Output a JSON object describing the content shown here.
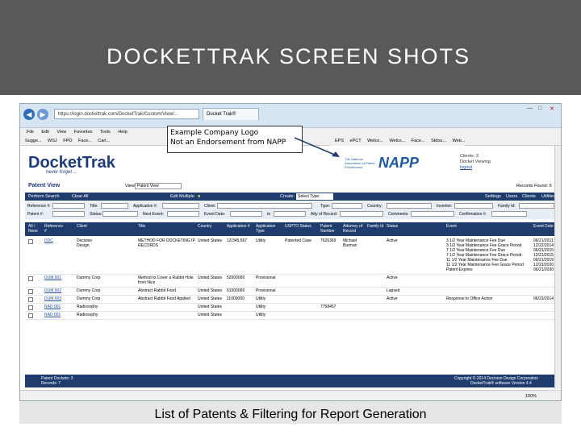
{
  "slide": {
    "title": "DOCKETTRAK SCREEN SHOTS",
    "caption": "List of Patents & Filtering for Report Generation"
  },
  "browser": {
    "url": "https://login.dockettrak.com/DocketTrak/Custom/View/...",
    "tab_label": "Docket Trak®",
    "back_icon": "back-arrow-icon",
    "forward_icon": "forward-arrow-icon",
    "menu": [
      "File",
      "Edit",
      "View",
      "Favorites",
      "Tools",
      "Help"
    ],
    "favorites": [
      "Sugge...",
      "WSJ",
      "FPO",
      "Face...",
      "Carl..."
    ],
    "favorites_right": [
      "EPS",
      "ePCT",
      "Welco...",
      "Welco...",
      "Face...",
      "Stdou...",
      "Web..."
    ],
    "zoom": "100%"
  },
  "callout": {
    "line1": "Example Company Logo",
    "line2": "Not an Endorsement from NAPP"
  },
  "header": {
    "logo_docket": "Docket",
    "logo_trak": "Trak",
    "tagline": "never forget ...",
    "napp_small": "The National Association of Patent Practitioners",
    "napp_word": "NAPP",
    "client_line1": "Clients: 3",
    "client_line2": "Docket Viewing",
    "client_line3": "logout"
  },
  "patent_view": {
    "title": "Patent View",
    "view_label": "View:",
    "view_value": "Patent View",
    "records_found": "Records Found: 6"
  },
  "toolbar": {
    "perform_search": "Perform Search",
    "clear_all": "Clear All",
    "edit_multiple": "Edit Multiple",
    "create_label": "Create:",
    "create_value": "Select Type:",
    "settings": "Settings",
    "users": "Users",
    "clients": "Clients",
    "utilities": "Utilities"
  },
  "filters": {
    "reference": "Reference #:",
    "title": "Title:",
    "application": "Application #:",
    "client": "Client:",
    "type": "Type:",
    "country": "Country:",
    "inventor": "Inventor:",
    "family_id": "Family Id:",
    "patent": "Patent #:",
    "status": "Status:",
    "next_event": "Next Event:",
    "event_date": "Event Date:",
    "to": "to",
    "atty": "Atty of Record:",
    "comments": "Comments:",
    "confirmation": "Confirmation #:"
  },
  "table": {
    "headers": [
      "All / None",
      "Reference #",
      "Client",
      "Title",
      "Country",
      "Application #",
      "Application Type",
      "USPTO Status",
      "Patent Number",
      "Attorney of Record",
      "Family Id",
      "Status",
      "Event",
      "Event Date"
    ],
    "rows": [
      {
        "ref": "DDC",
        "client": "Decision Design",
        "title": "METHOD FOR DOCKETING IP RECORDS",
        "country": "United States",
        "application": "12/345,567",
        "app_type": "Utility",
        "uspto": "Patented Case",
        "patent": "7626369",
        "attorney": "Michael Burman",
        "family": "",
        "status": "Active",
        "events": [
          "3 1/2 Year Maintenance Fee Due",
          "3 1/2 Year Maintenance Fee Grace Period",
          "7 1/2 Year Maintenance Fee Due",
          "7 1/2 Year Maintenance Fee Grace Period",
          "11 1/2 Year Maintenance Fee Due",
          "11 1/2 Year Maintenance Fee Grace Period",
          "Patent Expires"
        ],
        "dates": [
          "06/21/2011",
          "12/22/2014",
          "06/21/2015",
          "12/21/2015",
          "06/21/2019",
          "12/21/2020",
          "06/21/2030"
        ]
      },
      {
        "ref": "DUM 001",
        "client": "Dummy Corp",
        "title": "Method to Cover a Rabbit Hole from Nice",
        "country": "United States",
        "application": "52000000",
        "app_type": "Provisional",
        "uspto": "",
        "patent": "",
        "attorney": "",
        "family": "",
        "status": "Active",
        "events": [
          ""
        ],
        "dates": [
          ""
        ]
      },
      {
        "ref": "DUM 002",
        "client": "Dummy Corp",
        "title": "Abstract Rabbit Food",
        "country": "United States",
        "application": "61000000",
        "app_type": "Provisional",
        "uspto": "",
        "patent": "",
        "attorney": "",
        "family": "",
        "status": "Lapsed",
        "events": [
          ""
        ],
        "dates": [
          ""
        ]
      },
      {
        "ref": "DUM 003",
        "client": "Dummy Corp",
        "title": "Abstract Rabbit Food Applied",
        "country": "United States",
        "application": "11000000",
        "app_type": "Utility",
        "uspto": "",
        "patent": "",
        "attorney": "",
        "family": "",
        "status": "Active",
        "events": [
          "Response to Office Action"
        ],
        "dates": [
          "06/23/2014"
        ]
      },
      {
        "ref": "RAD 001",
        "client": "Radiosophy",
        "title": "",
        "country": "United States",
        "application": "",
        "app_type": "Utility",
        "uspto": "",
        "patent": "7758457",
        "attorney": "",
        "family": "",
        "status": "",
        "events": [
          ""
        ],
        "dates": [
          ""
        ]
      },
      {
        "ref": "RAD 001",
        "client": "Radiosophy",
        "title": "",
        "country": "United States",
        "application": "",
        "app_type": "Utility",
        "uspto": "",
        "patent": "",
        "attorney": "",
        "family": "",
        "status": "",
        "events": [
          ""
        ],
        "dates": [
          ""
        ]
      }
    ]
  },
  "footer": {
    "patent_dockets": "Patent Dockets: 3",
    "records": "Records: 7",
    "copyright": "Copyright © 2014 Decision Design Corporation",
    "version": "DocketTrak® software Version 4.4"
  },
  "colors": {
    "slide_header": "#595959",
    "nav_bar": "#1f3c6e",
    "logo": "#1d3a7a",
    "link": "#1d4ea8"
  }
}
